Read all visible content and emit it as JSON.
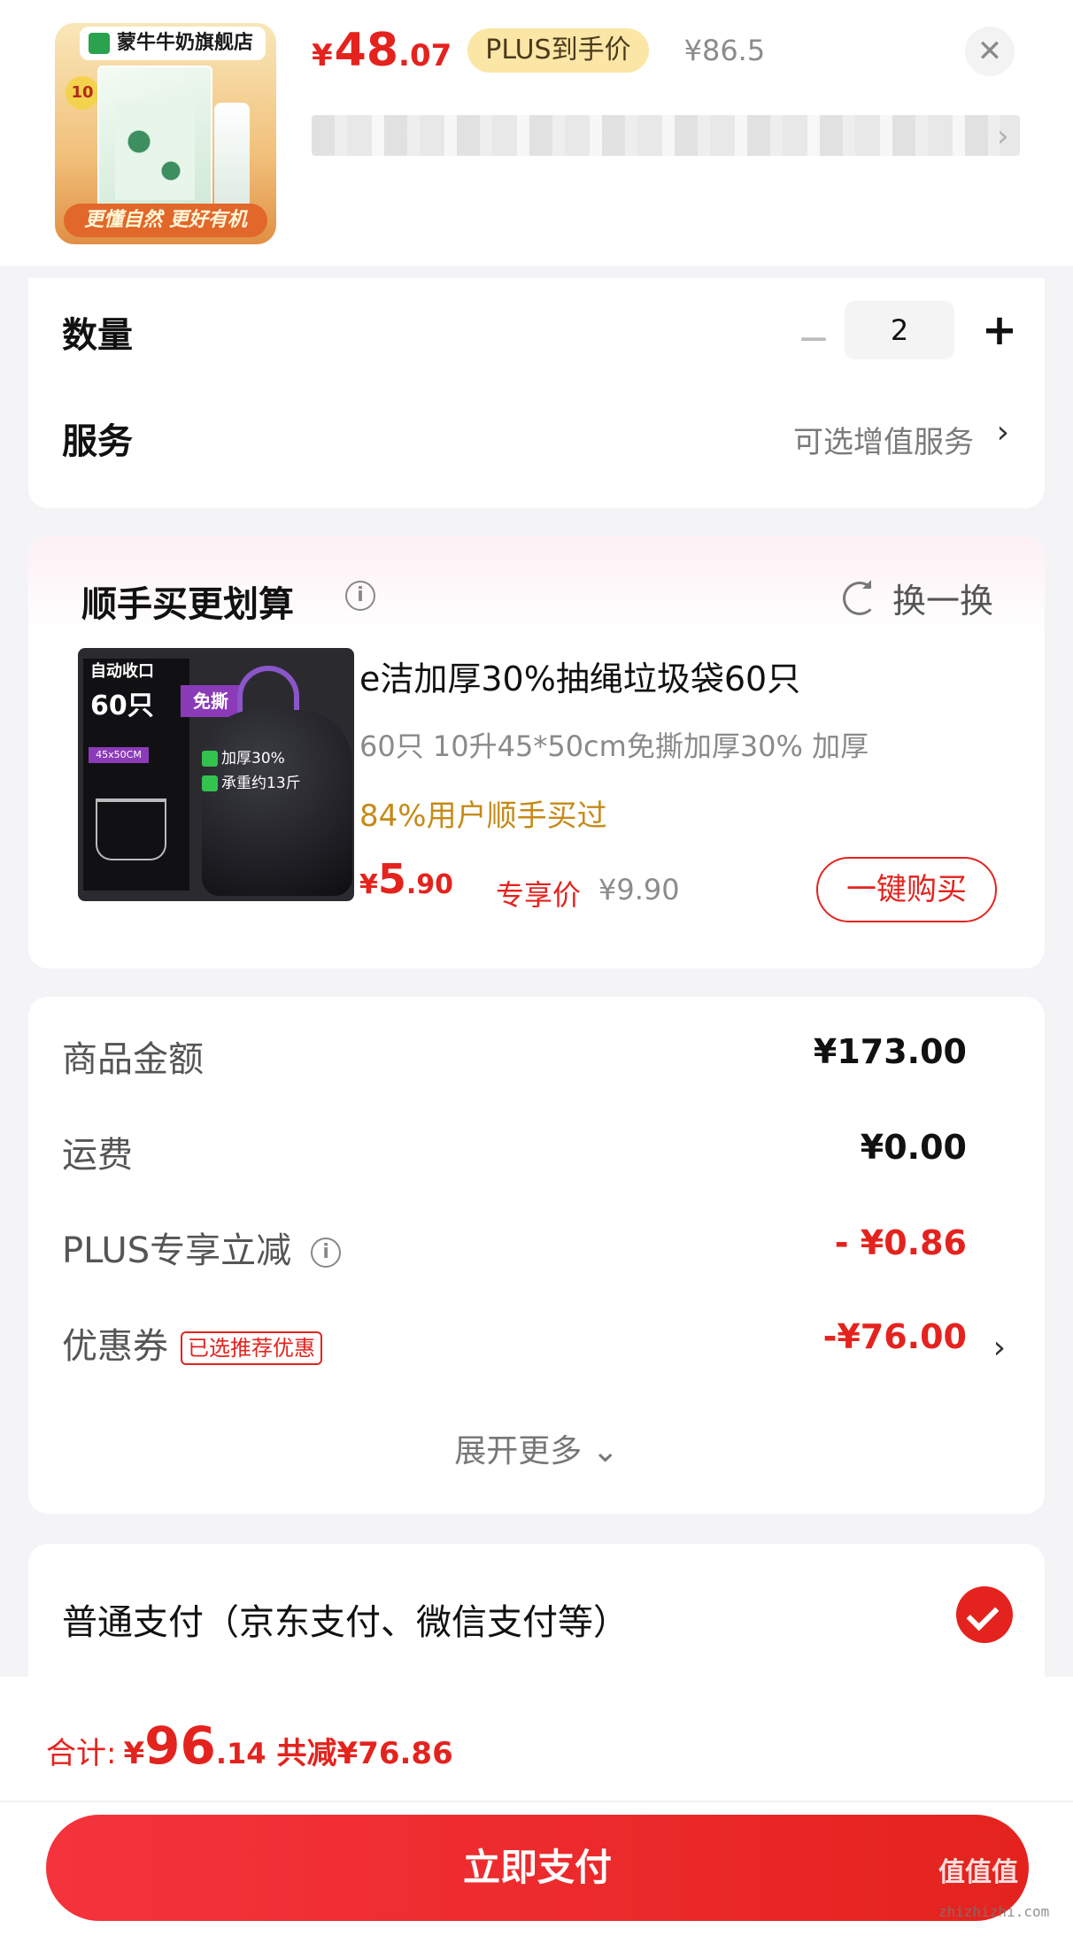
{
  "product": {
    "store_name": "蒙牛牛奶旗舰店",
    "badge": "10",
    "slogan": "更懂自然 更好有机",
    "price": {
      "symbol": "¥",
      "integer": "48",
      "decimal": ".07"
    },
    "price_tag": "PLUS到手价",
    "original_price": "¥86.5",
    "close_label": "✕",
    "blurred_chevron": "›"
  },
  "quantity": {
    "label": "数量",
    "minus": "−",
    "value": "2",
    "plus": "+"
  },
  "service": {
    "label": "服务",
    "value": "可选增值服务",
    "chevron": "›"
  },
  "bundle": {
    "title": "顺手买更划算",
    "info_glyph": "i",
    "swap_label": "换一换",
    "image_text": {
      "auto": "自动收口",
      "count": "60只",
      "free_tear": "免撕",
      "size": "45x50CM",
      "feature1": "加厚30%",
      "feature2": "承重约13斤"
    },
    "name": "e洁加厚30%抽绳垃圾袋60只",
    "spec": "60只 10升45*50cm免撕加厚30%   加厚",
    "social": "84%用户顺手买过",
    "price": {
      "symbol": "¥",
      "integer": "5",
      "decimal": ".90"
    },
    "price_tag": "专享价",
    "original_price": "¥9.90",
    "buy_button": "一键购买"
  },
  "summary": {
    "rows": [
      {
        "label": "商品金额",
        "value": "¥173.00"
      },
      {
        "label": "运费",
        "value": "¥0.00"
      },
      {
        "label": "PLUS专享立减",
        "value": "- ¥0.86"
      },
      {
        "label": "优惠券",
        "tag": "已选推荐优惠",
        "value": "-¥76.00"
      }
    ],
    "info_glyph": "i",
    "chevron": "›",
    "expand_label": "展开更多 ⌄"
  },
  "payment": {
    "label": "普通支付（京东支付、微信支付等）"
  },
  "footer": {
    "total_label": "合计:",
    "total": {
      "symbol": "¥",
      "integer": "96",
      "decimal": ".14"
    },
    "saved": "共减¥76.86",
    "pay_button": "立即支付"
  },
  "watermark": {
    "main": "值值值",
    "sub": "zhizhizhi.com"
  },
  "colors": {
    "accent": "#e4231e",
    "gold": "#c68a18",
    "plus_tag_bg": "#fbe6a6",
    "page_bg": "#f4f4f6"
  }
}
